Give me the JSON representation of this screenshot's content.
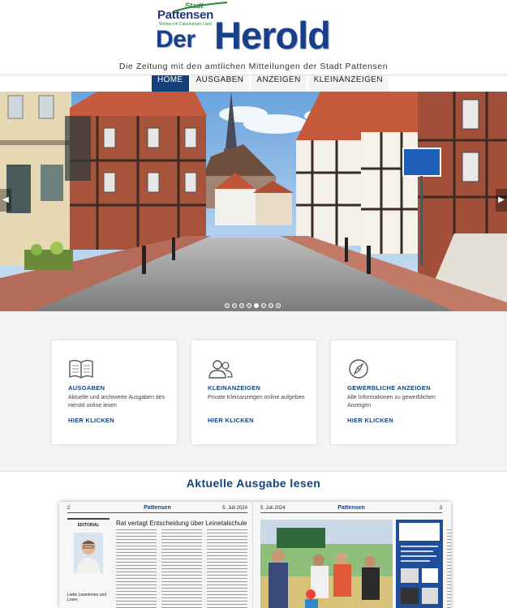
{
  "header": {
    "logo_stadt": "Stadt",
    "logo_pattensen": "Pattensen",
    "logo_claim": "Wohlen im Calenberger Land",
    "logo_der": "Der",
    "logo_herold": "Herold",
    "tagline": "Die Zeitung mit den amtlichen Mitteilungen der Stadt Pattensen"
  },
  "nav": {
    "items": [
      {
        "label": "HOME",
        "active": true
      },
      {
        "label": "AUSGABEN",
        "active": false
      },
      {
        "label": "ANZEIGEN",
        "active": false
      },
      {
        "label": "KLEINANZEIGEN",
        "active": false
      }
    ]
  },
  "slider": {
    "prev_icon": "chevron-left-icon",
    "next_icon": "chevron-right-icon",
    "slide_count": 8,
    "active_slide": 5
  },
  "cards": [
    {
      "icon": "open-book-icon",
      "title": "AUSGABEN",
      "text": "Aktuelle und archivierte Ausgaben des Herold online lesen",
      "link": "HIER KLICKEN"
    },
    {
      "icon": "users-icon",
      "title": "KLEINANZEIGEN",
      "text": "Private Kleinanzeigen online aufgeben",
      "link": "HIER KLICKEN"
    },
    {
      "icon": "compass-icon",
      "title": "GEWERBLICHE ANZEIGEN",
      "text": "Alle Informationen zu gewerblichen Anzeigen",
      "link": "HIER KLICKEN"
    }
  ],
  "current_issue": {
    "title": "Aktuelle Ausgabe lesen",
    "left_page_num": "2",
    "left_page_name": "Pattensen",
    "left_page_date": "5. Juli 2024",
    "right_page_date": "5. Juli 2024",
    "right_page_name": "Pattensen",
    "right_page_num": "3",
    "editorial_label": "EDITORIAL",
    "editorial_greeting": "Liebe Leserinnen und Leser,",
    "headline": "Rat vertagt Entscheidung über Leinetalschule"
  },
  "colors": {
    "brand_blue": "#15427a",
    "logo_green": "#2a8a3a",
    "section_bg": "#f4f4f4"
  }
}
